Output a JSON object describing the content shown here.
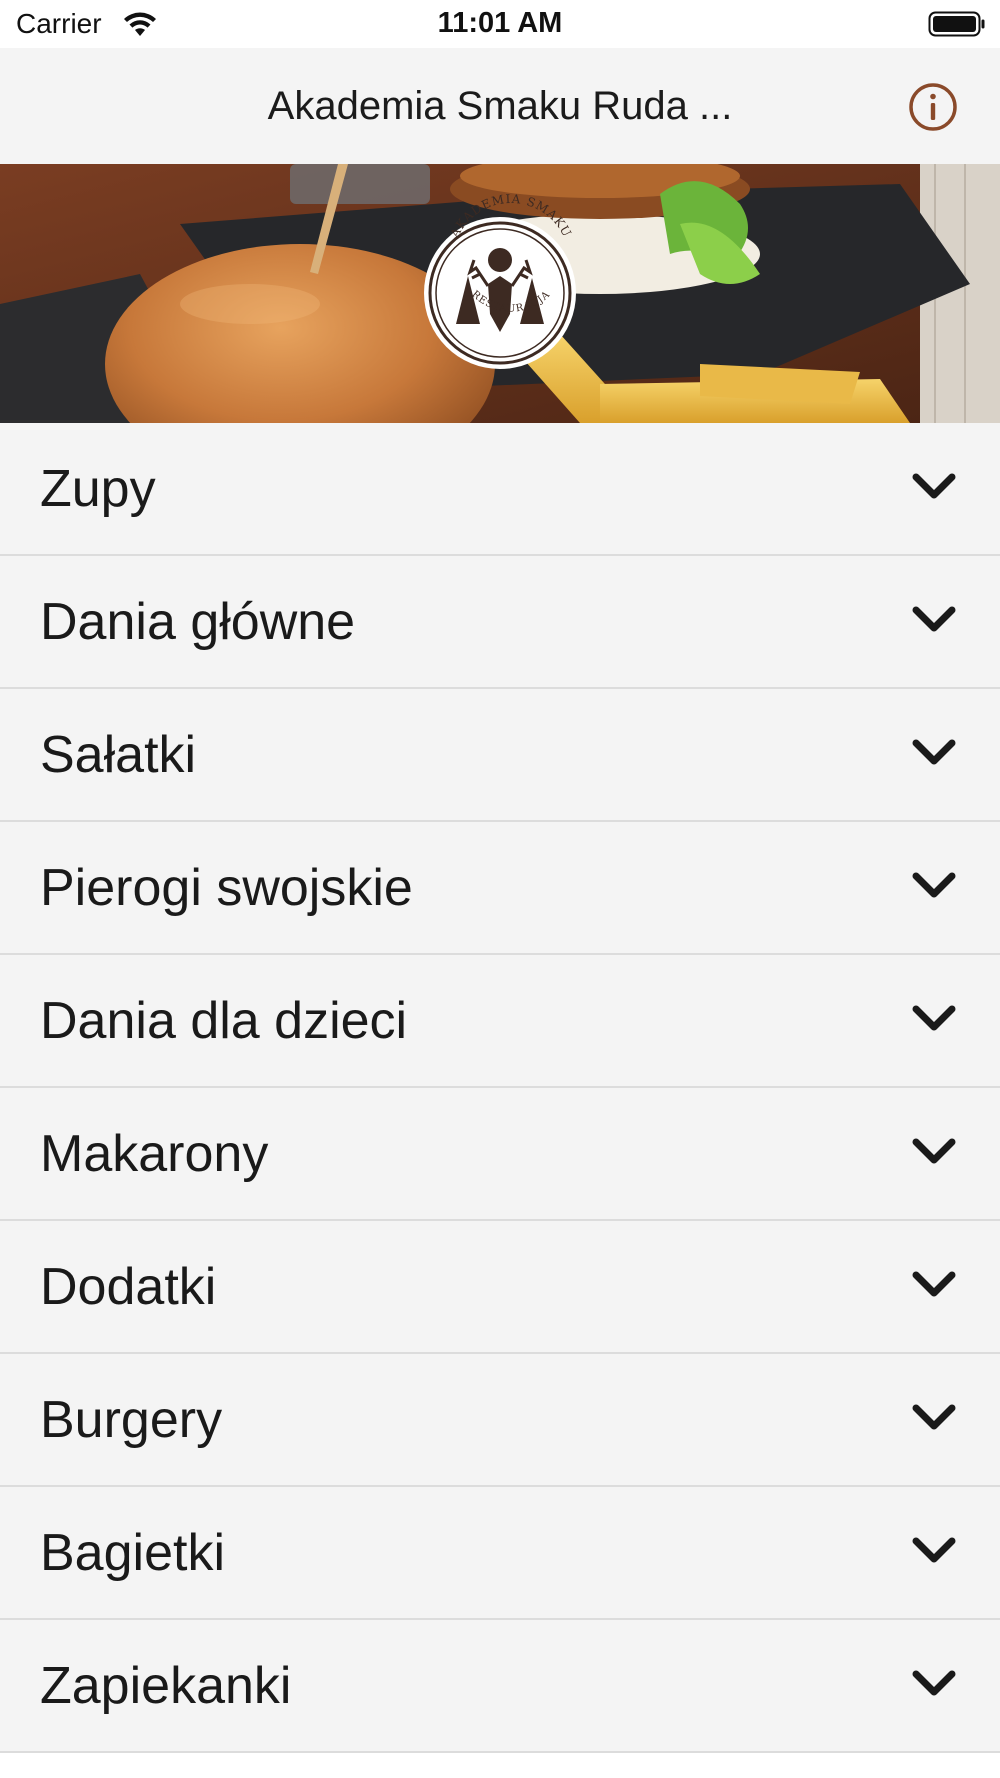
{
  "status_bar": {
    "carrier": "Carrier",
    "time": "11:01 AM"
  },
  "nav": {
    "title": "Akademia Smaku Ruda ...",
    "info_icon": "info-circle-icon",
    "accent_color": "#8a4a2a"
  },
  "hero": {
    "logo": {
      "top_text": "AKADEMIA SMAKU",
      "bottom_text": "RESTAURACJA"
    }
  },
  "menu": {
    "chevron_icon": "chevron-down-icon",
    "items": [
      {
        "label": "Zupy"
      },
      {
        "label": "Dania główne"
      },
      {
        "label": "Sałatki"
      },
      {
        "label": "Pierogi swojskie"
      },
      {
        "label": "Dania dla dzieci"
      },
      {
        "label": "Makarony"
      },
      {
        "label": "Dodatki"
      },
      {
        "label": "Burgery"
      },
      {
        "label": "Bagietki"
      },
      {
        "label": "Zapiekanki"
      }
    ]
  }
}
